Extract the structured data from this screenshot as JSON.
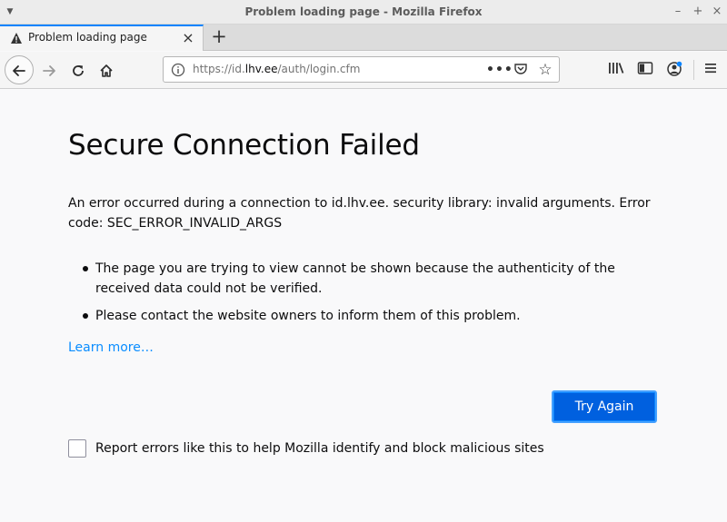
{
  "window": {
    "title": "Problem loading page - Mozilla Firefox",
    "minimize_icon": "minimize-icon",
    "maximize_icon": "maximize-icon",
    "close_icon": "close-icon"
  },
  "tabs": [
    {
      "label": "Problem loading page",
      "icon": "warning-icon",
      "active": true
    }
  ],
  "navbar": {
    "url_prefix": "https://id.",
    "url_host": "lhv.ee",
    "url_path": "/auth/login.cfm",
    "icons": [
      "back-icon",
      "forward-icon",
      "reload-icon",
      "home-icon",
      "info-icon",
      "page-actions-icon",
      "pocket-icon",
      "bookmark-star-icon",
      "library-icon",
      "sidebar-icon",
      "account-icon",
      "hamburger-menu-icon"
    ]
  },
  "error": {
    "title": "Secure Connection Failed",
    "description": "An error occurred during a connection to id.lhv.ee. security library: invalid arguments. Error code: SEC_ERROR_INVALID_ARGS",
    "bullets": [
      "The page you are trying to view cannot be shown because the authenticity of the received data could not be verified.",
      "Please contact the website owners to inform them of this problem."
    ],
    "learn_more": "Learn more…",
    "try_again": "Try Again",
    "report_label": "Report errors like this to help Mozilla identify and block malicious sites",
    "report_checked": false
  },
  "colors": {
    "accent": "#0a84ff",
    "button_bg": "#0060df",
    "link": "#0a8dff",
    "page_bg": "#f9f9fa"
  }
}
